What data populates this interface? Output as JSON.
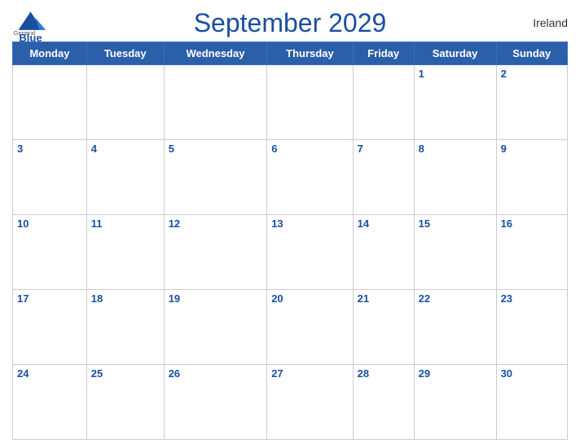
{
  "header": {
    "title": "September 2029",
    "country": "Ireland",
    "logo": {
      "general": "General",
      "blue": "Blue"
    }
  },
  "weekdays": [
    "Monday",
    "Tuesday",
    "Wednesday",
    "Thursday",
    "Friday",
    "Saturday",
    "Sunday"
  ],
  "weeks": [
    [
      null,
      null,
      null,
      null,
      null,
      1,
      2
    ],
    [
      3,
      4,
      5,
      6,
      7,
      8,
      9
    ],
    [
      10,
      11,
      12,
      13,
      14,
      15,
      16
    ],
    [
      17,
      18,
      19,
      20,
      21,
      22,
      23
    ],
    [
      24,
      25,
      26,
      27,
      28,
      29,
      30
    ]
  ],
  "colors": {
    "header_bg": "#2b5faa",
    "title_color": "#1a4fa0",
    "day_number_color": "#1a4fa0"
  }
}
